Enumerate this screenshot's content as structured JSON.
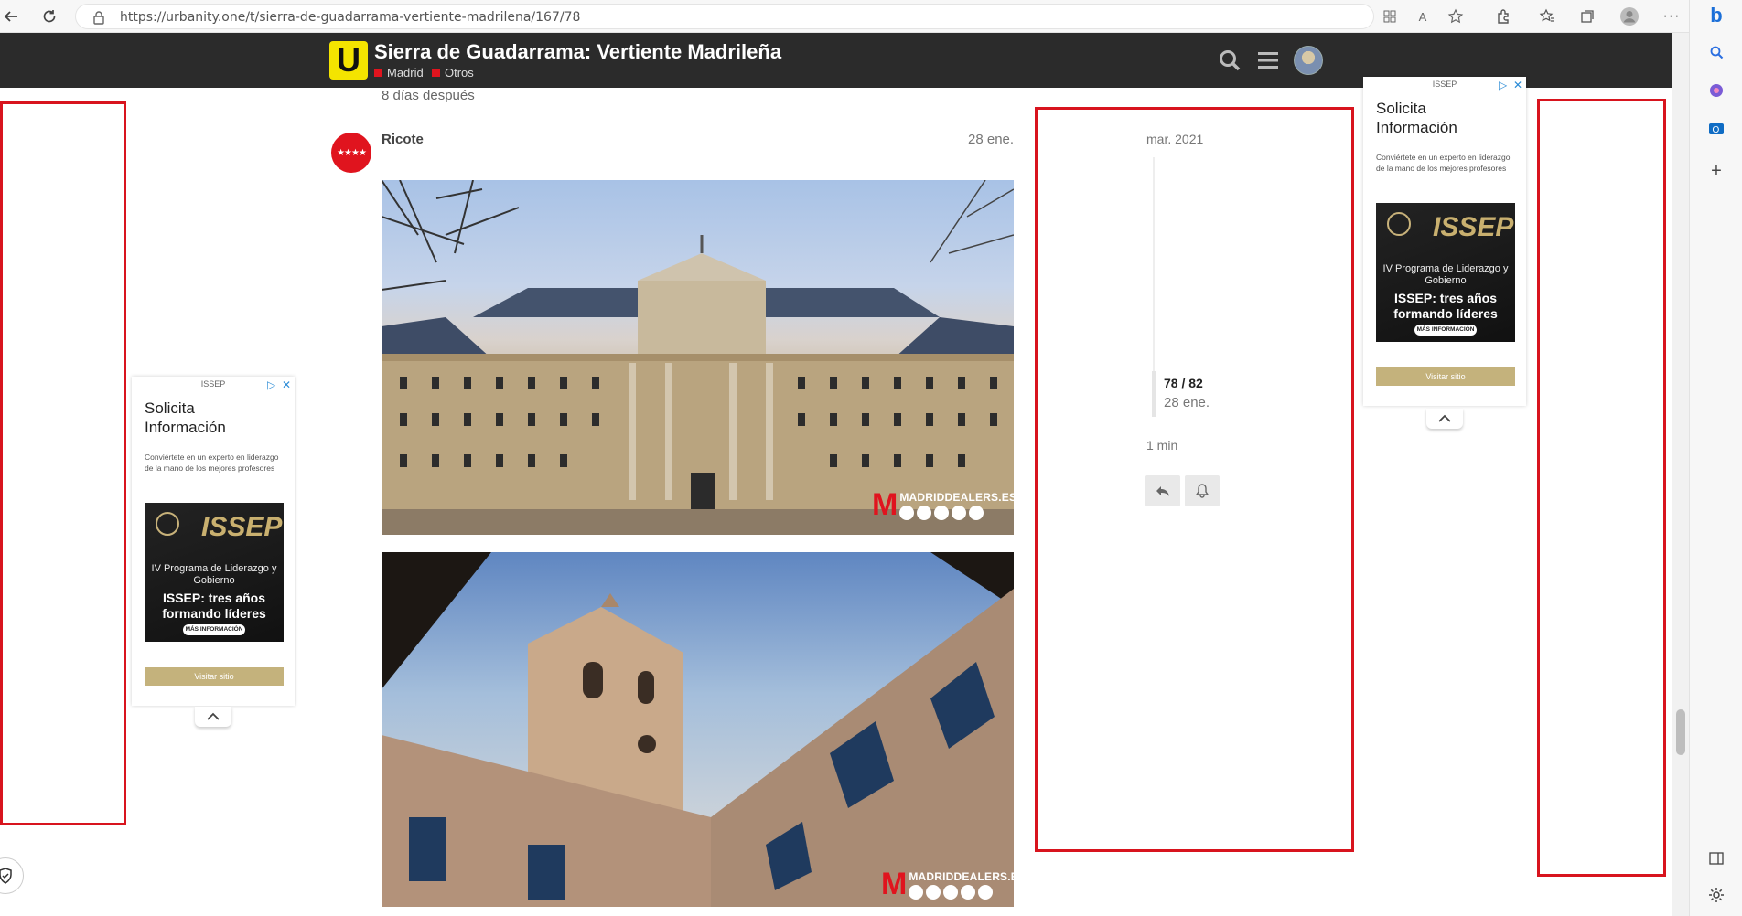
{
  "browser": {
    "url": "https://urbanity.one/t/sierra-de-guadarrama-vertiente-madrilena/167/78"
  },
  "header": {
    "logo_letter": "U",
    "title": "Sierra de Guadarrama: Vertiente Madrileña",
    "categories": [
      {
        "name": "Madrid",
        "color": "#e0141e"
      },
      {
        "name": "Otros",
        "color": "#e0141e"
      }
    ]
  },
  "post": {
    "time_gap": "8 días después",
    "username": "Ricote",
    "date": "28 ene.",
    "watermark": "MADRIDDEALERS.ES",
    "watermark_m": "M"
  },
  "timeline": {
    "start": "mar. 2021",
    "position": "78 / 82",
    "current_date": "28 ene.",
    "read_time": "1 min"
  },
  "ads": [
    {
      "source": "ISSEP",
      "title": "Solicita Información",
      "description": "Conviértete en un experto en liderazgo de la mano de los mejores profesores",
      "brand": "ISSEP",
      "program": "IV Programa de Liderazgo y Gobierno",
      "headline": "ISSEP: tres años formando líderes",
      "cta_small": "MÁS INFORMACIÓN",
      "button": "Visitar sitio"
    },
    {
      "source": "ISSEP",
      "title": "Solicita Información",
      "description": "Conviértete en un experto en liderazgo de la mano de los mejores profesores",
      "brand": "ISSEP",
      "program": "IV Programa de Liderazgo y Gobierno",
      "headline": "ISSEP: tres años formando líderes",
      "cta_small": "MÁS INFORMACIÓN",
      "button": "Visitar sitio"
    }
  ],
  "colors": {
    "header_bg": "#2b2b2b",
    "logo_yellow": "#f4e400",
    "accent_red": "#e0141e",
    "outline_red": "#d8141e"
  }
}
